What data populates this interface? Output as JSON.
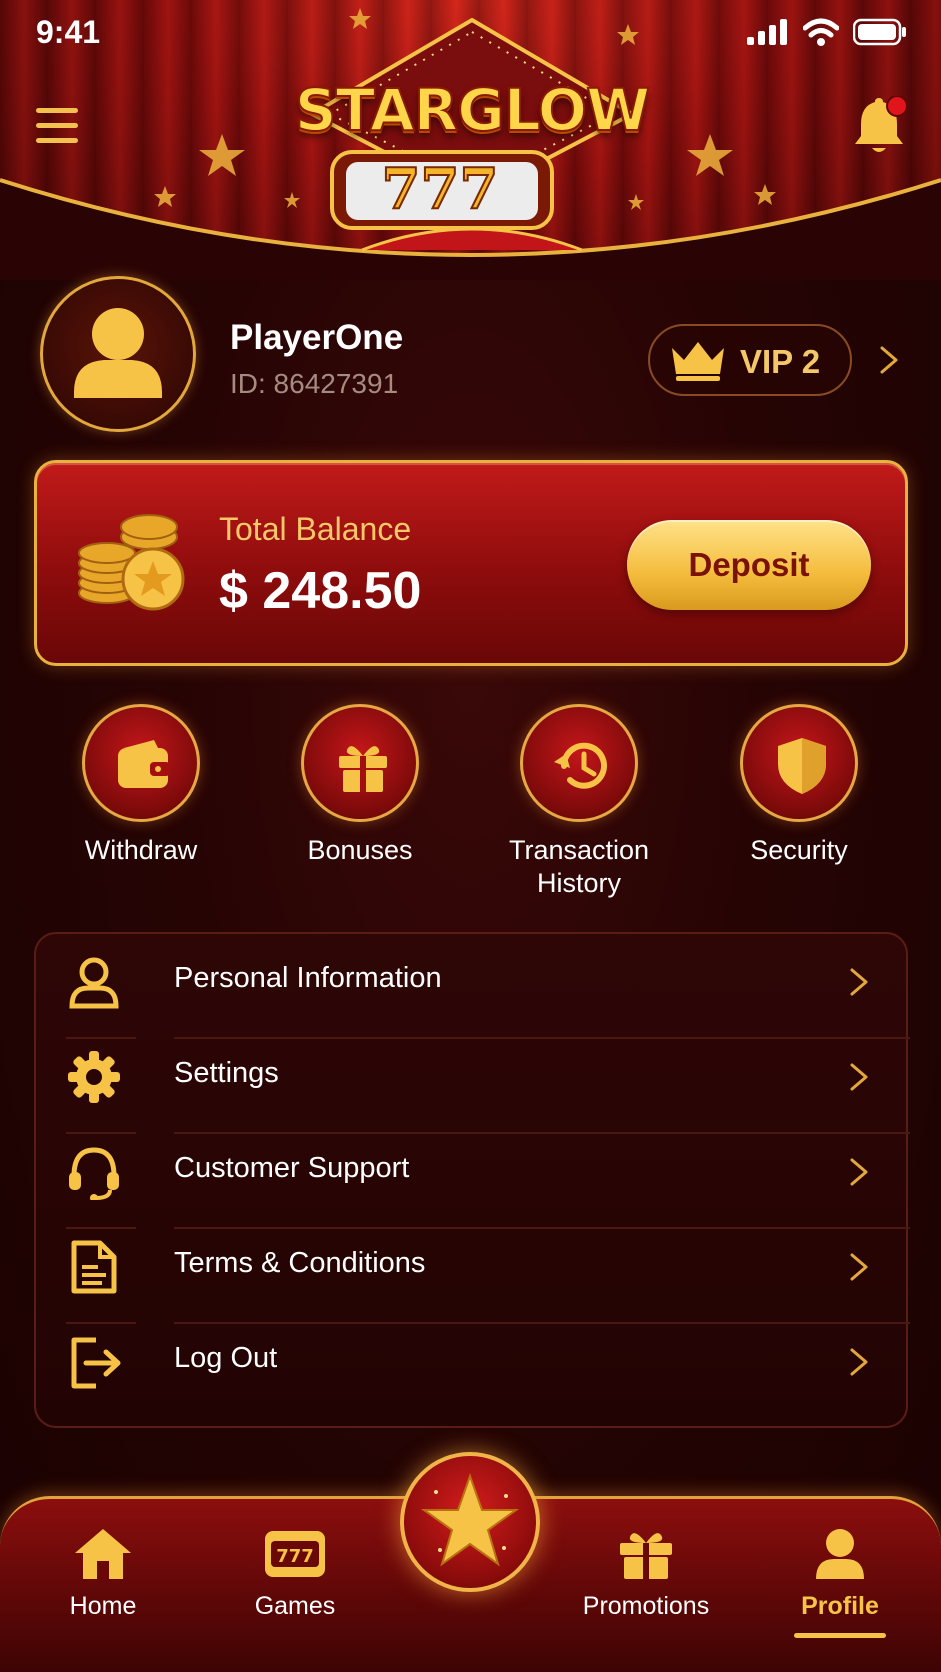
{
  "status_bar": {
    "time": "9:41"
  },
  "header": {
    "logo_text": "STARGLOW",
    "logo_reels": "777"
  },
  "profile": {
    "username": "PlayerOne",
    "player_id": "ID: 86427391",
    "vip_label": "VIP 2"
  },
  "balance": {
    "label": "Total Balance",
    "amount": "$ 248.50",
    "deposit_label": "Deposit"
  },
  "quick_actions": [
    {
      "label": "Withdraw",
      "icon": "wallet-icon"
    },
    {
      "label": "Bonuses",
      "icon": "gift-icon"
    },
    {
      "label": "Transaction History",
      "label_line1": "Transaction",
      "label_line2": "History",
      "icon": "history-icon"
    },
    {
      "label": "Security",
      "icon": "shield-icon"
    }
  ],
  "menu_items": [
    {
      "label": "Personal Information",
      "icon": "user-icon"
    },
    {
      "label": "Settings",
      "icon": "gear-icon"
    },
    {
      "label": "Customer Support",
      "icon": "headset-icon"
    },
    {
      "label": "Terms & Conditions",
      "icon": "document-icon"
    },
    {
      "label": "Log Out",
      "icon": "logout-icon"
    }
  ],
  "bottom_nav": {
    "items": [
      {
        "label": "Home",
        "icon": "home-icon"
      },
      {
        "label": "Games",
        "icon": "slot-machine-icon"
      },
      {
        "label": "Promotions",
        "icon": "gift-icon"
      },
      {
        "label": "Profile",
        "icon": "user-icon",
        "active": true
      }
    ],
    "center_icon": "star-icon"
  },
  "colors": {
    "gold": "#f6c347",
    "deep_red": "#2a0404",
    "card_red": "#b01414",
    "accent_notification": "#e0141a"
  }
}
